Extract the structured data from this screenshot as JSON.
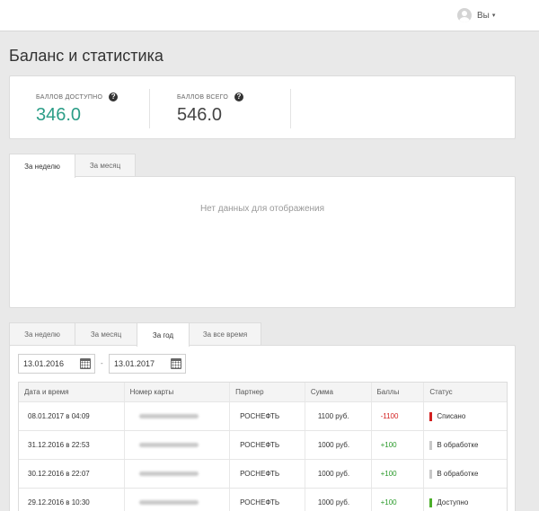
{
  "header": {
    "user_label": "Вы",
    "caret": "▾"
  },
  "page": {
    "title": "Баланс и статистика"
  },
  "stats": {
    "available": {
      "label": "Баллов доступно",
      "value": "346.0",
      "help": "?"
    },
    "total": {
      "label": "Баллов всего",
      "value": "546.0",
      "help": "?"
    }
  },
  "chart_panel": {
    "tabs": [
      "За неделю",
      "За месяц"
    ],
    "active_tab": 0,
    "empty_message": "Нет данных для отображения"
  },
  "history_panel": {
    "tabs": [
      "За неделю",
      "За месяц",
      "За год",
      "За все время"
    ],
    "active_tab": 2,
    "date_from": "13.01.2016",
    "date_separator": "-",
    "date_to": "13.01.2017",
    "columns": [
      "Дата и время",
      "Номер карты",
      "Партнер",
      "Сумма",
      "Баллы",
      "Статус"
    ],
    "rows": [
      {
        "date": "08.01.2017 в 04:09",
        "partner": "РОСНЕФТЬ",
        "sum": "1100 руб.",
        "points": "-1100",
        "status": "Списано",
        "status_color": "#d32020"
      },
      {
        "date": "31.12.2016 в 22:53",
        "partner": "РОСНЕФТЬ",
        "sum": "1000 руб.",
        "points": "+100",
        "status": "В обработке",
        "status_color": "#c8c8c8"
      },
      {
        "date": "30.12.2016 в 22:07",
        "partner": "РОСНЕФТЬ",
        "sum": "1000 руб.",
        "points": "+100",
        "status": "В обработке",
        "status_color": "#c8c8c8"
      },
      {
        "date": "29.12.2016 в 10:30",
        "partner": "РОСНЕФТЬ",
        "sum": "1000 руб.",
        "points": "+100",
        "status": "Доступно",
        "status_color": "#4caf2a"
      }
    ]
  },
  "colors": {
    "accent": "#2b9d87",
    "negative": "#d32020",
    "positive": "#2a9a2a"
  }
}
